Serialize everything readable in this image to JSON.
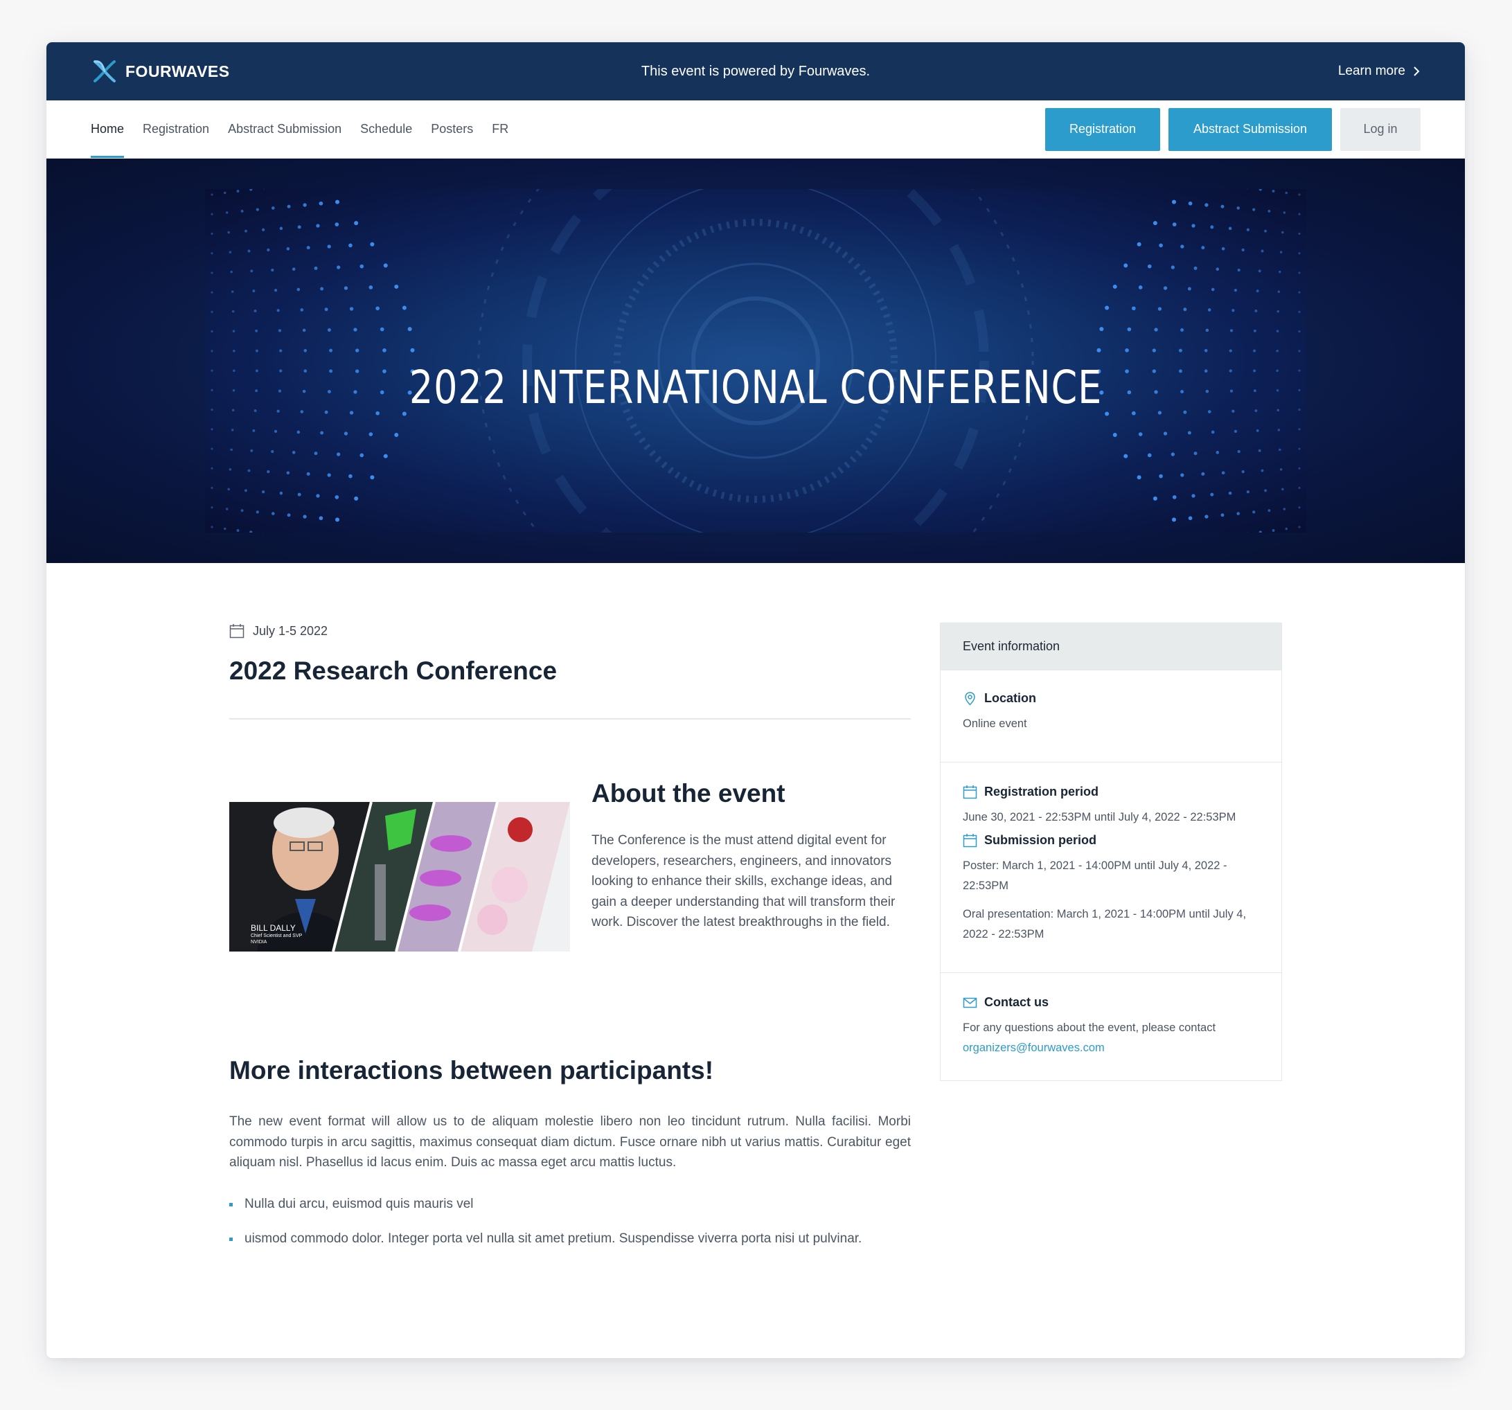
{
  "promo_bar": {
    "brand": "FOURWAVES",
    "message": "This event is powered by Fourwaves.",
    "learn_more": "Learn more"
  },
  "nav": {
    "links": [
      {
        "label": "Home",
        "active": true
      },
      {
        "label": "Registration"
      },
      {
        "label": "Abstract Submission"
      },
      {
        "label": "Schedule"
      },
      {
        "label": "Posters"
      },
      {
        "label": "FR"
      }
    ],
    "buttons": {
      "registration": "Registration",
      "abstract_submission": "Abstract Submission",
      "login": "Log in"
    }
  },
  "hero": {
    "title": "2022 INTERNATIONAL CONFERENCE"
  },
  "event": {
    "date": "July 1-5 2022",
    "title": "2022 Research Conference"
  },
  "about": {
    "heading": "About the event",
    "body": "The Conference is the must attend digital event for developers, researchers, engineers, and innovators looking to enhance their skills, exchange ideas, and gain a deeper understanding that will transform their work. Discover the latest breakthroughs in the field.",
    "image_caption_name": "BILL DALLY",
    "image_caption_role": "Chief Scientist and SVP",
    "image_caption_org": "NVIDIA"
  },
  "more": {
    "heading": "More interactions between participants!",
    "body": "The new event format will allow us to de aliquam molestie libero non leo tincidunt rutrum. Nulla facilisi. Morbi commodo turpis in arcu sagittis, maximus consequat diam dictum. Fusce ornare nibh ut varius mattis. Curabitur eget aliquam nisl. Phasellus id lacus enim. Duis ac massa eget arcu mattis luctus.",
    "bullets": [
      "Nulla dui arcu, euismod quis mauris vel",
      "uismod commodo dolor. Integer porta vel nulla sit amet pretium. Suspendisse viverra porta nisi ut pulvinar."
    ]
  },
  "sidebar": {
    "header": "Event information",
    "location_label": "Location",
    "location_value": "Online event",
    "registration_label": "Registration period",
    "registration_value": "June 30, 2021 - 22:53PM until July 4, 2022 - 22:53PM",
    "submission_label": "Submission period",
    "submission_poster": "Poster: March 1, 2021 - 14:00PM until July 4, 2022 - 22:53PM",
    "submission_oral": "Oral presentation: March 1, 2021 - 14:00PM until July 4, 2022 - 22:53PM",
    "contact_label": "Contact us",
    "contact_text": "For any questions about the event, please contact",
    "contact_email": "organizers@fourwaves.com"
  },
  "colors": {
    "promo_bar_bg": "#14325a",
    "accent": "#2b9ccb",
    "heading": "#182536",
    "body_text": "#4b5563",
    "sidebar_header_bg": "#e8ebec"
  },
  "icons": [
    "fourwaves-logo-icon",
    "chevron-right-icon",
    "calendar-icon",
    "location-pin-icon",
    "mail-icon"
  ]
}
